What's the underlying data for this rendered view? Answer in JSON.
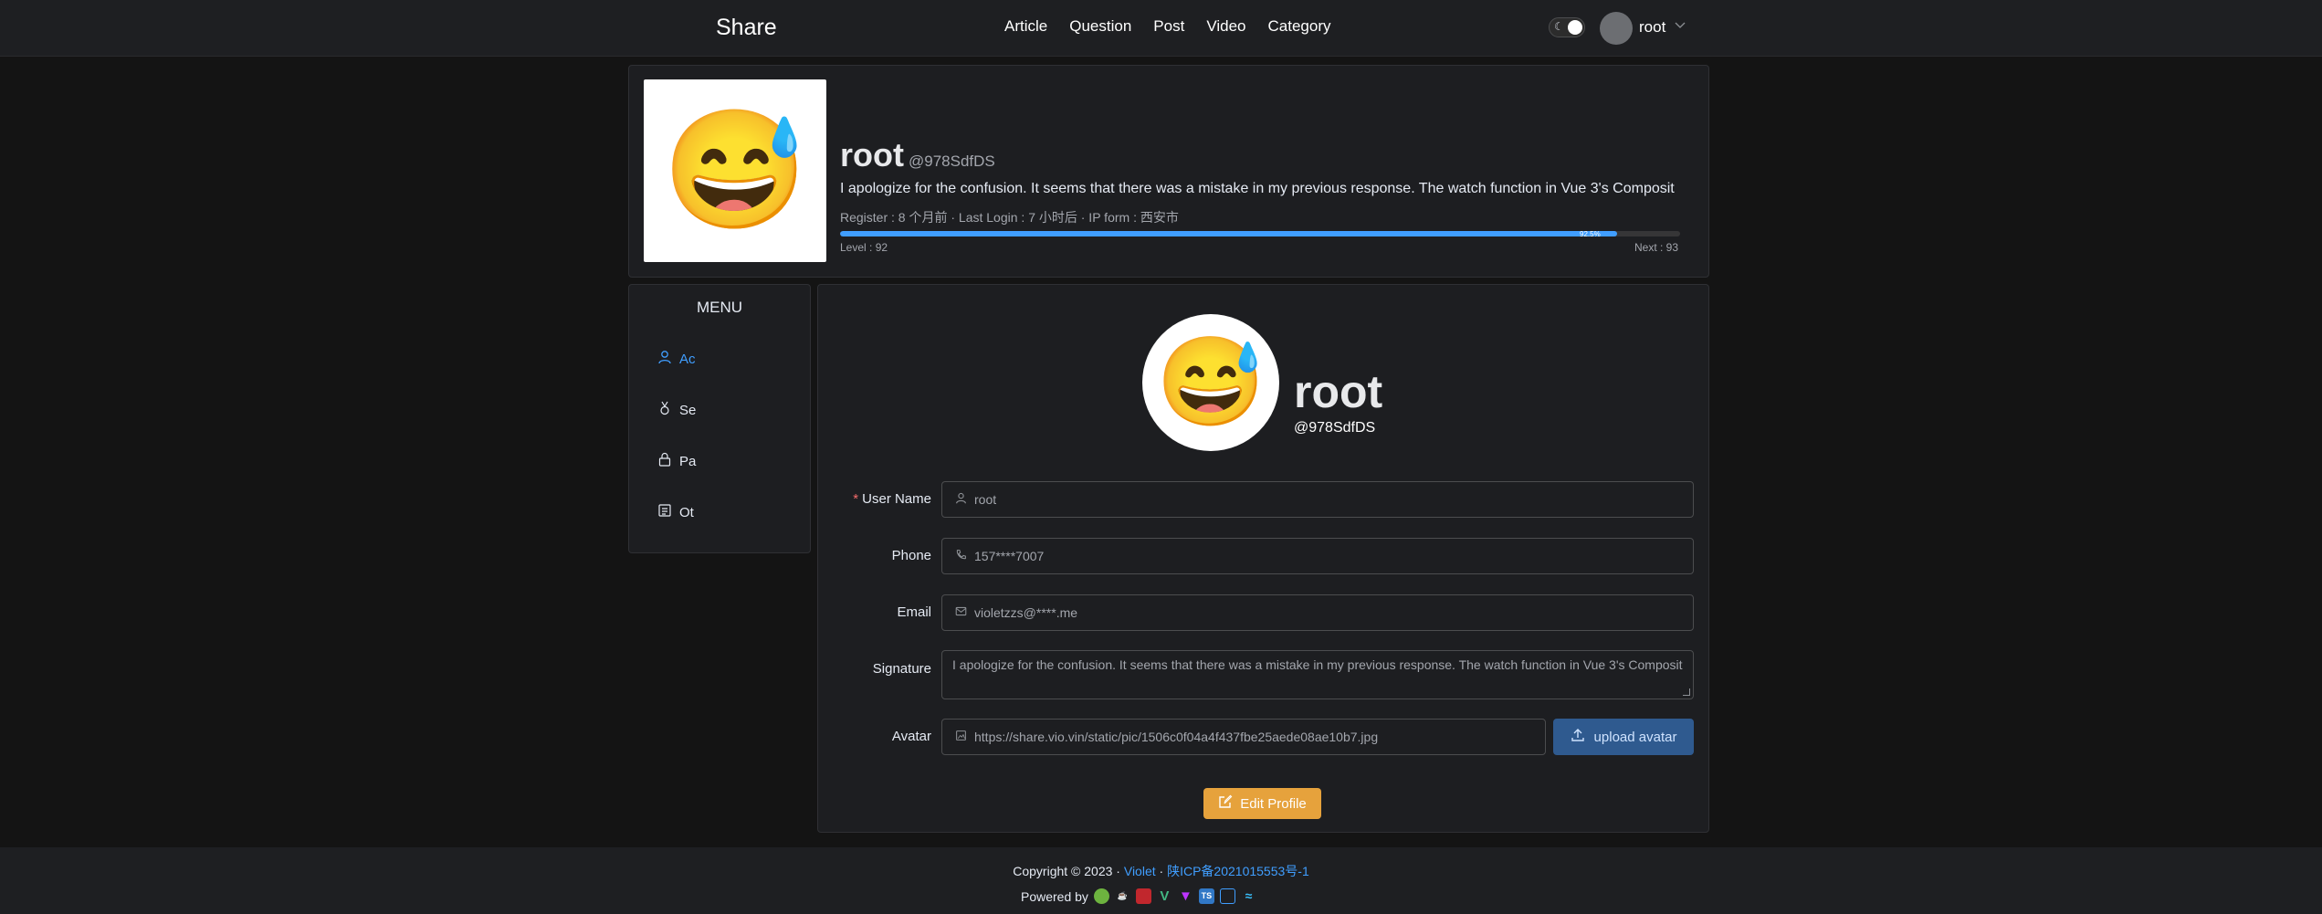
{
  "nav": {
    "brand": "Share",
    "links": [
      "Article",
      "Question",
      "Post",
      "Video",
      "Category"
    ],
    "user": "root"
  },
  "profile": {
    "name": "root",
    "handle": "@978SdfDS",
    "signature": "I apologize for the confusion. It seems that there was a mistake in my previous response. The watch function in Vue 3's Composit",
    "meta": "Register : 8 个月前 · Last Login : 7 小时后 · IP form : 西安市",
    "progress_percent": 92.5,
    "progress_text": "92.5%",
    "level_label": "Level : 92",
    "next_label": "Next : 93",
    "avatar_emoji": "😅"
  },
  "menu": {
    "title": "MENU",
    "items": [
      {
        "label": "Ac",
        "icon": "user-icon",
        "active": true
      },
      {
        "label": "Se",
        "icon": "medal-icon",
        "active": false
      },
      {
        "label": "Pa",
        "icon": "lock-icon",
        "active": false
      },
      {
        "label": "Ot",
        "icon": "list-icon",
        "active": false
      }
    ]
  },
  "form": {
    "name": "root",
    "handle": "@978SdfDS",
    "avatar_emoji": "😅",
    "labels": {
      "username": "User Name",
      "phone": "Phone",
      "email": "Email",
      "signature": "Signature",
      "avatar": "Avatar"
    },
    "values": {
      "username": "root",
      "phone": "157****7007",
      "email": "violetzzs@****.me",
      "signature": "I apologize for the confusion. It seems that there was a mistake in my previous response. The watch function in Vue 3's Composit",
      "avatar": "https://share.vio.vin/static/pic/1506c0f04a4f437fbe25aede08ae10b7.jpg"
    },
    "upload_label": "upload avatar",
    "edit_label": "Edit Profile"
  },
  "footer": {
    "copyright": "Copyright © 2023 ·",
    "author": "Violet",
    "separator": "·",
    "icp": "陕ICP备2021015553号-1",
    "powered_by": "Powered by"
  },
  "colors": {
    "accent": "#409eff",
    "warning": "#e6a23c",
    "danger": "#f56c6c",
    "background": "#141414"
  }
}
